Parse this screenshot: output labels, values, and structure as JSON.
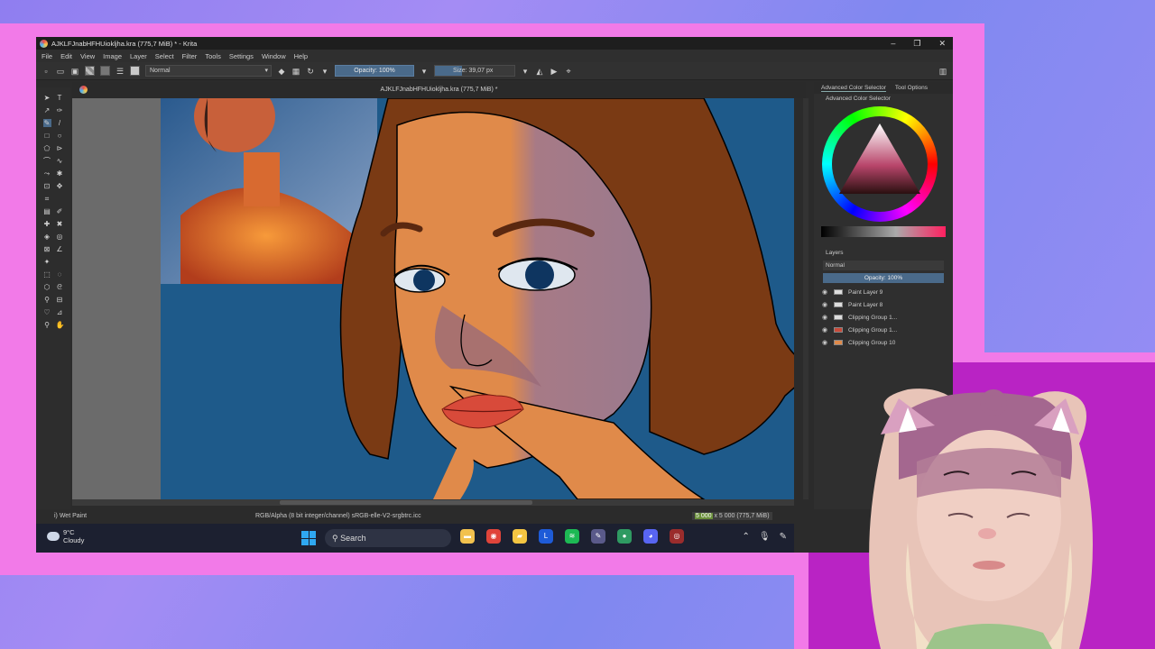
{
  "window": {
    "title": "AJKLFJnabHFHUiokljha.kra (775,7 MiB) * - Krita",
    "controls": [
      "–",
      "❐",
      "✕"
    ]
  },
  "menu": [
    "File",
    "Edit",
    "View",
    "Image",
    "Layer",
    "Select",
    "Filter",
    "Tools",
    "Settings",
    "Window",
    "Help"
  ],
  "toolbar": {
    "blend_mode": "Normal",
    "opacity": "Opacity: 100%",
    "size": "Size: 39,07 px"
  },
  "document": {
    "tab_title": "AJKLFJnabHFHUiokljha.kra (775,7 MiB) *",
    "close": "✕"
  },
  "status": {
    "brush": "i) Wet Paint",
    "color_profile": "RGB/Alpha (8 bit integer/channel)  sRGB-elle-V2-srgbtrc.icc",
    "dims_highlight": "5 000",
    "dims_rest": " x 5 000 (775,7 MiB)"
  },
  "dock": {
    "tabs": [
      "Advanced Color Selector",
      "Tool Options"
    ],
    "color_selector_title": "Advanced Color Selector",
    "layers_title": "Layers",
    "layers_blend": "Normal",
    "layers_opacity": "Opacity:  100%",
    "layers": [
      "Paint Layer 9",
      "Paint Layer 8",
      "Clipping Group 1...",
      "Clipping Group 1...",
      "Clipping Group 10"
    ]
  },
  "taskbar": {
    "temperature": "9°C",
    "condition": "Cloudy",
    "search_placeholder": "Search",
    "apps": [
      {
        "name": "file-explorer-icon",
        "glyph": "▬",
        "color": "#f2c14e"
      },
      {
        "name": "chrome-icon",
        "glyph": "◉",
        "color": "#e0443a"
      },
      {
        "name": "folder-icon",
        "glyph": "▰",
        "color": "#f4c542"
      },
      {
        "name": "l-app-icon",
        "glyph": "L",
        "color": "#1e5bd8"
      },
      {
        "name": "spotify-icon",
        "glyph": "≋",
        "color": "#1db954"
      },
      {
        "name": "krita-icon",
        "glyph": "✎",
        "color": "#5a5a8a"
      },
      {
        "name": "green-app-icon",
        "glyph": "●",
        "color": "#2f9a62"
      },
      {
        "name": "discord-icon",
        "glyph": "◕",
        "color": "#5865f2"
      },
      {
        "name": "record-icon",
        "glyph": "◎",
        "color": "#9a2c2c"
      }
    ]
  },
  "colors": {
    "frame_pink": "#f27ae8",
    "cam_magenta": "#b923c4",
    "canvas_blue": "#1e5a8a",
    "hair": "#7a3a14",
    "skin": "#e08a4a"
  }
}
